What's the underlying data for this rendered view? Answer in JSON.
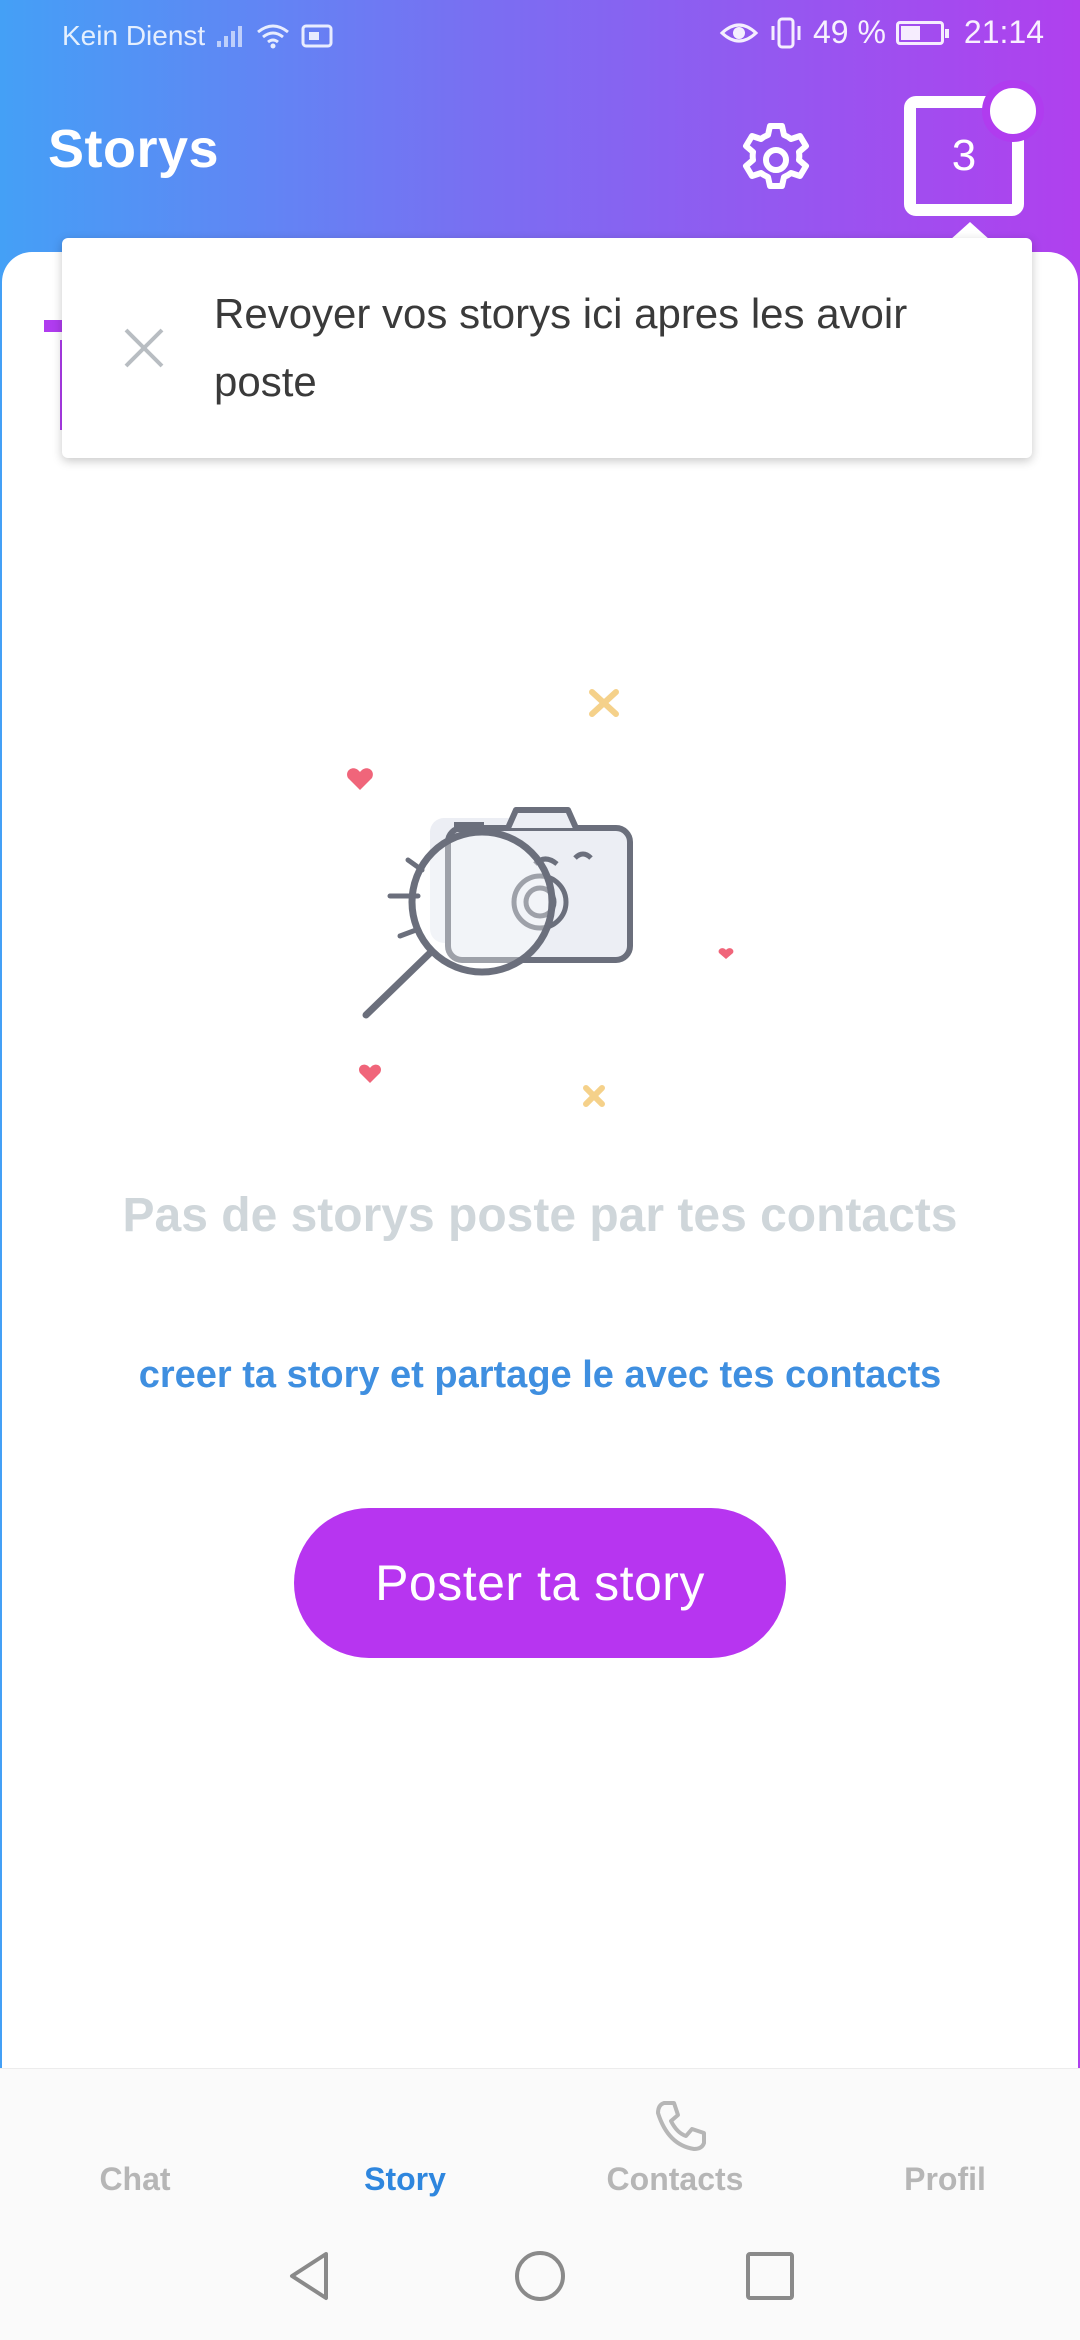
{
  "status_bar": {
    "carrier": "Kein Dienst",
    "battery_percent": "49 %",
    "time": "21:14"
  },
  "header": {
    "title": "Storys",
    "settings_icon": "gear-icon",
    "story_count": "3"
  },
  "tooltip": {
    "text": "Revoyer vos storys ici apres les avoir poste",
    "close_icon": "close-icon"
  },
  "empty_state": {
    "illustration": "camera-magnifier-illustration",
    "title": "Pas de storys poste par tes contacts",
    "subtitle": "creer ta story et partage le avec tes contacts",
    "button_label": "Poster ta story"
  },
  "bottom_nav": {
    "items": [
      {
        "label": "Chat",
        "active": false
      },
      {
        "label": "Story",
        "active": true
      },
      {
        "label": "Contacts",
        "active": false,
        "icon": "phone-icon"
      },
      {
        "label": "Profil",
        "active": false
      }
    ]
  },
  "colors": {
    "gradient_start": "#44a0f6",
    "gradient_end": "#b040ee",
    "accent_purple": "#b735f0",
    "accent_blue": "#2e86de",
    "empty_title": "#cfd6da"
  }
}
